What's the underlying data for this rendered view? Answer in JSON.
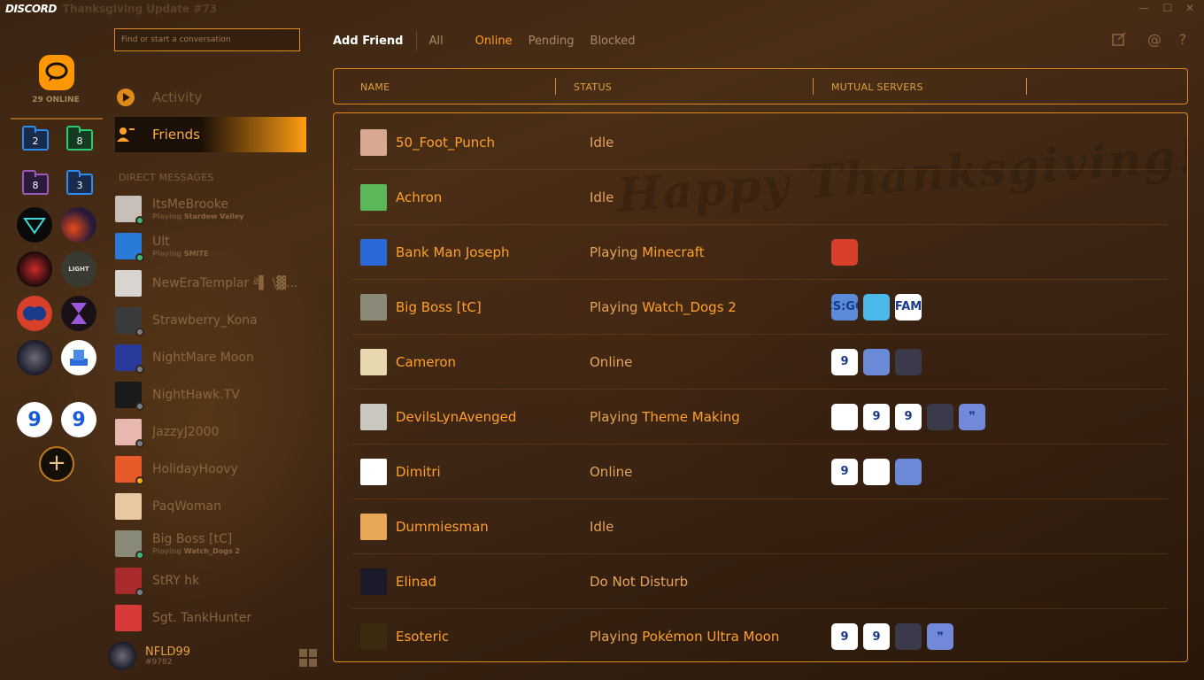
{
  "app": {
    "logo": "DISCORD",
    "title": "Thanksgiving Update #73"
  },
  "window_controls": {
    "minimize": "—",
    "maximize": "☐",
    "close": "✕"
  },
  "rail": {
    "online_count": "29 ONLINE",
    "folders": [
      {
        "count": "2",
        "color": "#2d8cf0"
      },
      {
        "count": "8",
        "color": "#2ecc71"
      },
      {
        "count": "8",
        "color": "#9b59b6"
      },
      {
        "count": "3",
        "color": "#2d8cf0"
      }
    ],
    "add_server": "+"
  },
  "search": {
    "placeholder": "Find or start a conversation"
  },
  "nav": {
    "activity": "Activity",
    "friends": "Friends"
  },
  "dm_header": "DIRECT MESSAGES",
  "dms": [
    {
      "name": "ItsMeBrooke",
      "activity_prefix": "Playing ",
      "activity": "Stardew Valley",
      "status": "#43b581",
      "color": "#c8c0b8"
    },
    {
      "name": "Ult",
      "activity_prefix": "Playing ",
      "activity": "SMITE",
      "status": "#43b581",
      "color": "#2a7ad8"
    },
    {
      "name": "NewEraTemplar ª▌ \\▓...",
      "activity_prefix": "",
      "activity": "",
      "status": "",
      "color": "#d8d4d0"
    },
    {
      "name": "Strawberry_Kona",
      "activity_prefix": "",
      "activity": "",
      "status": "#747f8d",
      "color": "#3a3a3a"
    },
    {
      "name": "NightMare Moon",
      "activity_prefix": "",
      "activity": "",
      "status": "#747f8d",
      "color": "#2a3a9a"
    },
    {
      "name": "NightHawk.TV",
      "activity_prefix": "",
      "activity": "",
      "status": "#747f8d",
      "color": "#1a1a1a"
    },
    {
      "name": "JazzyJ2000",
      "activity_prefix": "",
      "activity": "",
      "status": "#747f8d",
      "color": "#e8b8b0"
    },
    {
      "name": "HolidayHoovy",
      "activity_prefix": "",
      "activity": "",
      "status": "#faa61a",
      "color": "#e85a2a"
    },
    {
      "name": "PaqWoman",
      "activity_prefix": "",
      "activity": "",
      "status": "",
      "color": "#e8c8a0"
    },
    {
      "name": "Big Boss [tC]",
      "activity_prefix": "Playing ",
      "activity": "Watch_Dogs 2",
      "status": "#43b581",
      "color": "#8a8a78"
    },
    {
      "name": "StRY hk",
      "activity_prefix": "",
      "activity": "",
      "status": "#747f8d",
      "color": "#a82a2a"
    },
    {
      "name": "Sgt. TankHunter",
      "activity_prefix": "",
      "activity": "",
      "status": "",
      "color": "#d83a3a"
    }
  ],
  "user": {
    "name": "NFLD99",
    "tag": "#9782"
  },
  "tabs": {
    "add_friend": "Add Friend",
    "all": "All",
    "online": "Online",
    "pending": "Pending",
    "blocked": "Blocked"
  },
  "top_icons": {
    "new_group": "new-group-icon",
    "mentions": "@",
    "help": "?"
  },
  "table": {
    "col_name": "NAME",
    "col_status": "STATUS",
    "col_mutual": "MUTUAL SERVERS",
    "watermark": "Happy Thanksgiving!"
  },
  "friends": [
    {
      "name": "50_Foot_Punch",
      "status_prefix": "Idle",
      "game": "",
      "avatar": "#d8a890",
      "mutuals": []
    },
    {
      "name": "Achron",
      "status_prefix": "Idle",
      "game": "",
      "avatar": "#5ab85a",
      "mutuals": []
    },
    {
      "name": "Bank Man Joseph",
      "status_prefix": "Playing ",
      "game": "Minecraft",
      "avatar": "#2a6ad8",
      "mutuals": [
        {
          "label": "",
          "bg": "#d8402a"
        }
      ]
    },
    {
      "name": "Big Boss [tC]",
      "status_prefix": "Playing ",
      "game": "Watch_Dogs 2",
      "avatar": "#8a8a78",
      "mutuals": [
        {
          "label": "CS:GO",
          "bg": "#5a8ad8"
        },
        {
          "label": "",
          "bg": "#4ab8e8"
        },
        {
          "label": "FAM",
          "bg": "#ffffff"
        }
      ]
    },
    {
      "name": "Cameron",
      "status_prefix": "Online",
      "game": "",
      "avatar": "#e8d8b0",
      "mutuals": [
        {
          "label": "9",
          "bg": "#ffffff"
        },
        {
          "label": "",
          "bg": "#6a8ad8"
        },
        {
          "label": "",
          "bg": "#3a3a4a"
        }
      ]
    },
    {
      "name": "DevilsLynAvenged",
      "status_prefix": "Playing ",
      "game": "Theme Making",
      "avatar": "#c8c8c0",
      "mutuals": [
        {
          "label": "",
          "bg": "#ffffff"
        },
        {
          "label": "9",
          "bg": "#ffffff"
        },
        {
          "label": "9",
          "bg": "#ffffff"
        },
        {
          "label": "",
          "bg": "#3a3a4a"
        },
        {
          "label": "❞",
          "bg": "#7289da"
        }
      ]
    },
    {
      "name": "Dimitri",
      "status_prefix": "Online",
      "game": "",
      "avatar": "#ffffff",
      "mutuals": [
        {
          "label": "9",
          "bg": "#ffffff"
        },
        {
          "label": "",
          "bg": "#ffffff"
        },
        {
          "label": "",
          "bg": "#6a8ad8"
        }
      ]
    },
    {
      "name": "Dummiesman",
      "status_prefix": "Idle",
      "game": "",
      "avatar": "#e8a858",
      "mutuals": []
    },
    {
      "name": "Elinad",
      "status_prefix": "Do Not Disturb",
      "game": "",
      "avatar": "#1a1a2a",
      "mutuals": []
    },
    {
      "name": "Esoteric",
      "status_prefix": "Playing ",
      "game": "Pokémon Ultra Moon",
      "avatar": "#3a2a10",
      "mutuals": [
        {
          "label": "9",
          "bg": "#ffffff"
        },
        {
          "label": "9",
          "bg": "#ffffff"
        },
        {
          "label": "",
          "bg": "#3a3a4a"
        },
        {
          "label": "❞",
          "bg": "#7289da"
        }
      ]
    }
  ]
}
